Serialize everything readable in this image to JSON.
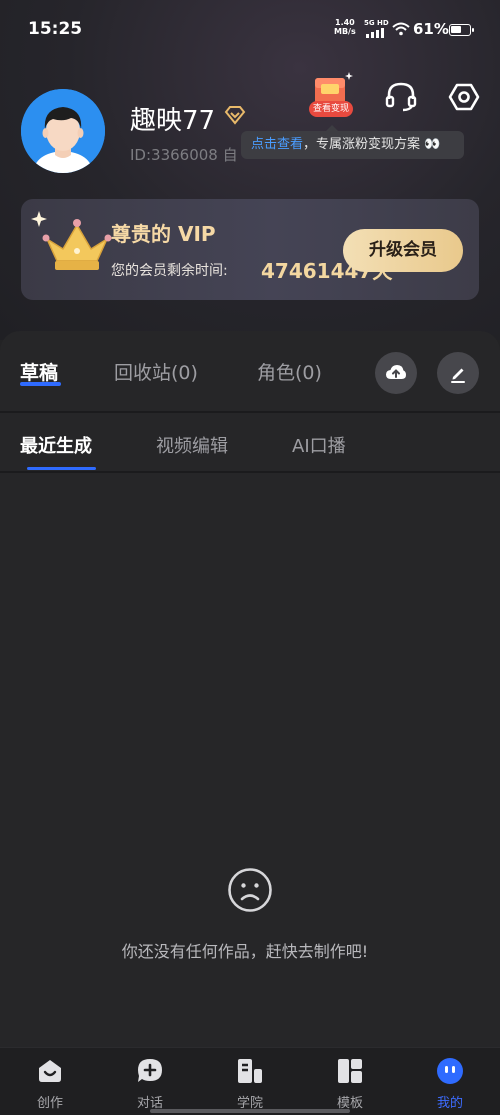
{
  "status_bar": {
    "time": "15:25",
    "net_speed_value": "1.40",
    "net_speed_unit": "MB/s",
    "network_type": "5G HD",
    "battery_percent": "61%",
    "battery_level": 0.61
  },
  "profile": {
    "username": "趣映77",
    "user_id": "ID:3366008 自",
    "cash_badge": "查看变现",
    "promo_link": "点击查看",
    "promo_text": "，专属涨粉变现方案 👀"
  },
  "vip": {
    "title": "尊贵的 VIP",
    "remaining_label": "您的会员剩余时间:",
    "remaining_value": "47461447天",
    "upgrade_label": "升级会员"
  },
  "tabs": {
    "drafts": "草稿",
    "recycle": "回收站(0)",
    "roles": "角色(0)"
  },
  "sub_tabs": {
    "recent": "最近生成",
    "video_edit": "视频编辑",
    "ai_voice": "AI口播"
  },
  "empty_state": {
    "message": "你还没有任何作品，赶快去制作吧!"
  },
  "nav": {
    "create": "创作",
    "chat": "对话",
    "academy": "学院",
    "templates": "模板",
    "mine": "我的"
  },
  "colors": {
    "accent": "#2f6bff",
    "vip_gold": "#f3d7a0",
    "promo_red": "#e84a3f"
  }
}
